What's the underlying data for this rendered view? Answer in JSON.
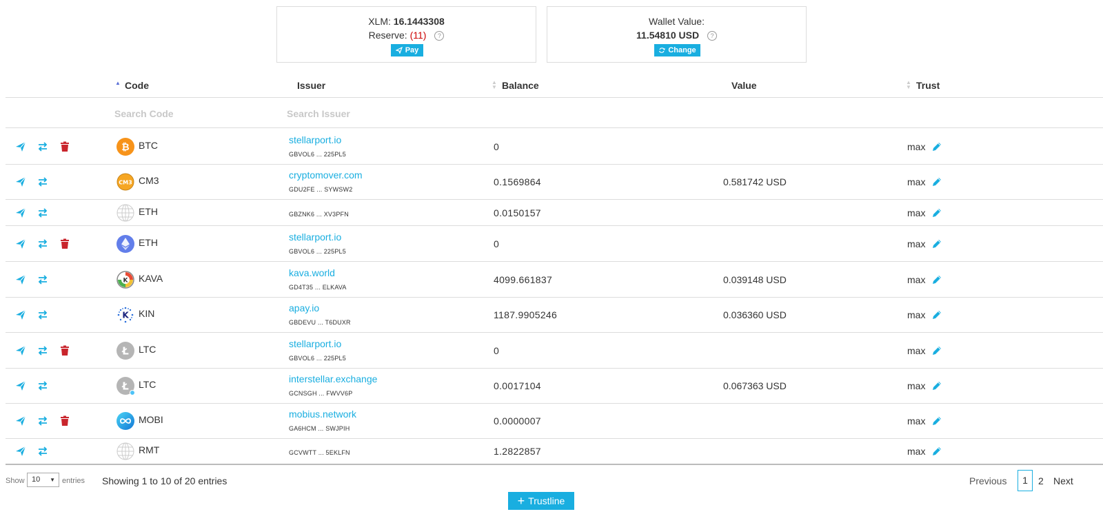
{
  "summary": {
    "xlm_label": "XLM:",
    "xlm_value": "16.1443308",
    "reserve_label": "Reserve:",
    "reserve_value": "(11)",
    "pay_label": "Pay",
    "wallet_label": "Wallet Value:",
    "wallet_value": "11.54810 USD",
    "change_label": "Change"
  },
  "table": {
    "headers": {
      "code": "Code",
      "issuer": "Issuer",
      "balance": "Balance",
      "value": "Value",
      "trust": "Trust"
    },
    "search_code_placeholder": "Search Code",
    "search_issuer_placeholder": "Search Issuer",
    "rows": [
      {
        "coin": "btc-icon",
        "code": "BTC",
        "issuer": "stellarport.io",
        "key": "GBVOL6 ... 225PL5",
        "balance": "0",
        "value": "",
        "trust": "max",
        "deletable": true
      },
      {
        "coin": "cm3-icon",
        "code": "CM3",
        "issuer": "cryptomover.com",
        "key": "GDU2FE ... SYWSW2",
        "balance": "0.1569864",
        "value": "0.581742 USD",
        "trust": "max",
        "deletable": false
      },
      {
        "coin": "globe-icon",
        "code": "ETH",
        "issuer": "",
        "key": "GBZNK6 ... XV3PFN",
        "balance": "0.0150157",
        "value": "",
        "trust": "max",
        "deletable": false
      },
      {
        "coin": "eth-icon",
        "code": "ETH",
        "issuer": "stellarport.io",
        "key": "GBVOL6 ... 225PL5",
        "balance": "0",
        "value": "",
        "trust": "max",
        "deletable": true
      },
      {
        "coin": "kava-icon",
        "code": "KAVA",
        "issuer": "kava.world",
        "key": "GD4T35 ... ELKAVA",
        "balance": "4099.661837",
        "value": "0.039148 USD",
        "trust": "max",
        "deletable": false
      },
      {
        "coin": "kin-icon",
        "code": "KIN",
        "issuer": "apay.io",
        "key": "GBDEVU ... T6DUXR",
        "balance": "1187.9905246",
        "value": "0.036360 USD",
        "trust": "max",
        "deletable": false
      },
      {
        "coin": "ltc-icon",
        "code": "LTC",
        "issuer": "stellarport.io",
        "key": "GBVOL6 ... 225PL5",
        "balance": "0",
        "value": "",
        "trust": "max",
        "deletable": true
      },
      {
        "coin": "ltc-icon",
        "code": "LTC",
        "issuer": "interstellar.exchange",
        "key": "GCNSGH ... FWVV6P",
        "balance": "0.0017104",
        "value": "0.067363 USD",
        "trust": "max",
        "deletable": false
      },
      {
        "coin": "mobi-icon",
        "code": "MOBI",
        "issuer": "mobius.network",
        "key": "GA6HCM ... SWJPIH",
        "balance": "0.0000007",
        "value": "",
        "trust": "max",
        "deletable": true
      },
      {
        "coin": "globe-icon",
        "code": "RMT",
        "issuer": "",
        "key": "GCVWTT ... 5EKLFN",
        "balance": "1.2822857",
        "value": "",
        "trust": "max",
        "deletable": false
      }
    ]
  },
  "footer": {
    "show_label": "Show",
    "page_size": "10",
    "entries_label": "entries",
    "showing_text": "Showing 1 to 10 of 20 entries",
    "previous": "Previous",
    "page1": "1",
    "page2": "2",
    "next": "Next",
    "trustline_label": "Trustline"
  },
  "colors": {
    "accent": "#19aee0",
    "danger": "#c9252c",
    "reserve": "#cc0000"
  }
}
